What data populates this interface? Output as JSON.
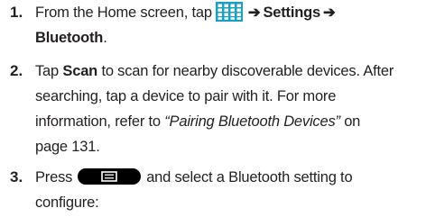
{
  "step1": {
    "number": "1.",
    "line1_prefix": "From the Home screen, tap",
    "apps_icon": "apps-grid-icon",
    "arrow1": "➔",
    "settings_label": "Settings",
    "arrow2": "➔",
    "bluetooth_label": "Bluetooth",
    "line2_suffix": "."
  },
  "step2": {
    "number": "2.",
    "tap_word": "Tap",
    "scan_label": "Scan",
    "line1_rest": "to scan for nearby discoverable devices. After",
    "line2": "searching, tap a device to pair with it. For more",
    "line3_prefix": "information, refer to",
    "xref": "“Pairing Bluetooth Devices”",
    "line3_suffix": "on",
    "line4": "page 131."
  },
  "step3": {
    "number": "3.",
    "press_word": "Press",
    "menu_icon": "menu-key-icon",
    "line1_rest": "and select a Bluetooth setting to",
    "line2": "configure:"
  },
  "colors": {
    "text": "#231f20",
    "key_fill": "#000000",
    "apps_icon_color": "#1aa0c6"
  }
}
